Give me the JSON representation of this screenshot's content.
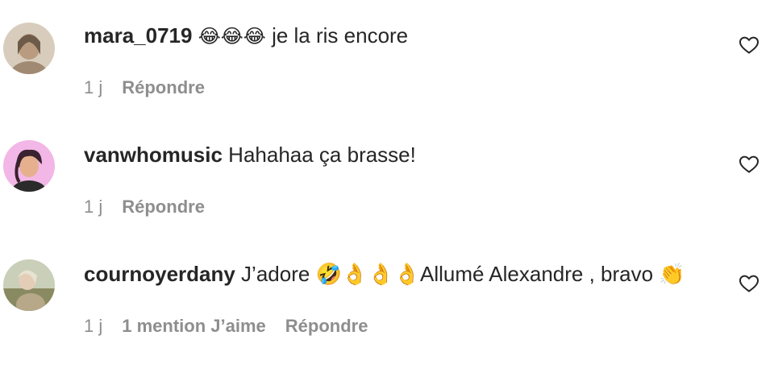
{
  "comments": [
    {
      "username": "mara_0719",
      "emojis": "😂😂😂",
      "text": " je la ris encore",
      "time": "1 j",
      "likes": "",
      "reply": "Répondre",
      "avatar_icon": "user-avatar-photo",
      "avatar_color": "#c9b49a"
    },
    {
      "username": "vanwhomusic",
      "emojis": "",
      "text": " Hahahaa ça brasse!",
      "time": "1 j",
      "likes": "",
      "reply": "Répondre",
      "avatar_icon": "user-avatar-photo",
      "avatar_color": "#e39ad8"
    },
    {
      "username": "cournoyerdany",
      "emojis": "",
      "text": " J’adore 🤣👌👌👌Allumé Alexandre , bravo 👏",
      "time": "1 j",
      "likes": "1 mention J’aime",
      "reply": "Répondre",
      "avatar_icon": "user-avatar-photo",
      "avatar_color": "#a8b490"
    }
  ],
  "icons": {
    "like": "heart-outline-icon"
  },
  "colors": {
    "text": "#262626",
    "secondary": "#8e8e8e"
  }
}
